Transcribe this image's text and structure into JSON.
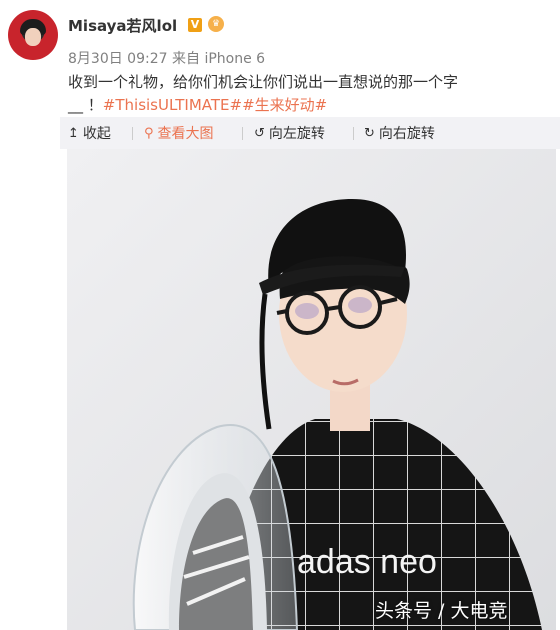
{
  "post": {
    "username": "Misaya若风lol",
    "verified_badge": "V",
    "date": "8月30日 09:27",
    "source_prefix": "来自",
    "source": "iPhone 6",
    "text_line1": "收到一个礼物，给你们机会让你们说出一直想说的那一个字",
    "text_blank": "__",
    "text_exclaim": "！",
    "hashtag1": "#ThisisULTIMATE#",
    "hashtag2": "#生来好动#"
  },
  "toolbar": {
    "collapse": "收起",
    "view_large": "查看大图",
    "rotate_left": "向左旋转",
    "rotate_right": "向右旋转"
  },
  "photo": {
    "shirt_text": "adas neo",
    "watermark": "头条号 / 大电竞"
  },
  "colors": {
    "accent": "#eb7350",
    "toolbar_bg": "#f2f2f5",
    "meta_text": "#808080"
  }
}
